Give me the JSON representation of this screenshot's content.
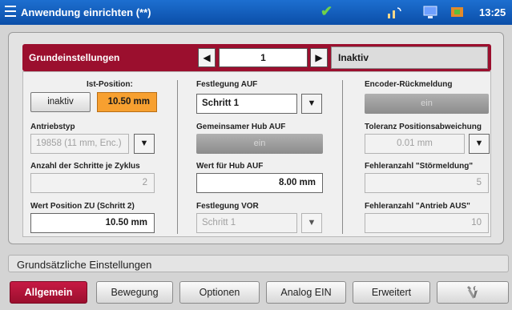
{
  "titlebar": {
    "title": "Anwendung einrichten (**)",
    "time": "13:25",
    "icons": [
      "menu-icon",
      "checkmark-icon",
      "network-icon",
      "monitor-icon",
      "plugin-icon"
    ]
  },
  "header": {
    "section_label": "Grundeinstellungen",
    "step_value": "1",
    "status": "Inaktiv",
    "prev_arrow": "◀",
    "next_arrow": "▶"
  },
  "col1": {
    "ist_position_label": "Ist-Position:",
    "inaktiv_button": "inaktiv",
    "ist_position_value": "10.50 mm",
    "antriebstyp_label": "Antriebstyp",
    "antriebstyp_value": "19858 (11 mm, Enc.)",
    "schritte_label": "Anzahl der Schritte je Zyklus",
    "schritte_value": "2",
    "wert_zu_label": "Wert Position ZU (Schritt 2)",
    "wert_zu_value": "10.50  mm"
  },
  "col2": {
    "festlegung_auf_label": "Festlegung AUF",
    "festlegung_auf_value": "Schritt 1",
    "hub_auf_label": "Gemeinsamer Hub AUF",
    "hub_auf_button": "ein",
    "wert_hub_label": "Wert für Hub AUF",
    "wert_hub_value": "8.00  mm",
    "festlegung_vor_label": "Festlegung VOR",
    "festlegung_vor_value": "Schritt 1"
  },
  "col3": {
    "encoder_label": "Encoder-Rückmeldung",
    "encoder_button": "ein",
    "toleranz_label": "Toleranz Positionsabweichung",
    "toleranz_value": "0.01  mm",
    "stoer_label": "Fehleranzahl \"Störmeldung\"",
    "stoer_value": "5",
    "aus_label": "Fehleranzahl \"Antrieb AUS\"",
    "aus_value": "10"
  },
  "dropdown_glyph": "▼",
  "footer": {
    "section_title": "Grundsätzliche Einstellungen",
    "tabs": [
      "Allgemein",
      "Bewegung",
      "Optionen",
      "Analog EIN",
      "Erweitert"
    ],
    "tools_icon": "tools-icon"
  },
  "colors": {
    "accent": "#9b0f2e",
    "titlebar": "#0b4ea8",
    "highlight": "#f7a030"
  }
}
